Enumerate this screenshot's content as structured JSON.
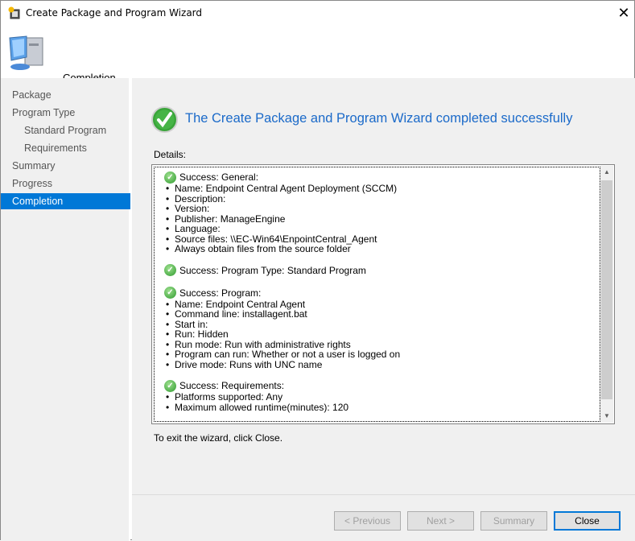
{
  "window": {
    "title": "Create Package and Program Wizard",
    "close": "✕"
  },
  "header": {
    "title": "Completion"
  },
  "nav": [
    {
      "label": "Package",
      "sub": false
    },
    {
      "label": "Program Type",
      "sub": false
    },
    {
      "label": "Standard Program",
      "sub": true
    },
    {
      "label": "Requirements",
      "sub": true
    },
    {
      "label": "Summary",
      "sub": false
    },
    {
      "label": "Progress",
      "sub": false
    },
    {
      "label": "Completion",
      "sub": false,
      "active": true
    }
  ],
  "main": {
    "heading": "The Create Package and Program Wizard completed successfully",
    "details_label": "Details:",
    "sections": [
      {
        "title": "Success: General:",
        "items": [
          "Name: Endpoint Central Agent Deployment (SCCM)",
          "Description:",
          "Version:",
          "Publisher: ManageEngine",
          "Language:",
          "Source files: \\\\EC-Win64\\EnpointCentral_Agent",
          "Always obtain files from the source folder"
        ]
      },
      {
        "title": "Success: Program Type: Standard Program",
        "items": []
      },
      {
        "title": "Success: Program:",
        "items": [
          "Name: Endpoint Central Agent",
          "Command line: installagent.bat",
          "Start in:",
          "Run: Hidden",
          "Run mode: Run with administrative rights",
          "Program can run: Whether or not a user is logged on",
          "Drive mode: Runs with UNC name"
        ]
      },
      {
        "title": "Success: Requirements:",
        "items": [
          "Platforms supported: Any",
          "Maximum allowed runtime(minutes): 120"
        ]
      }
    ],
    "exit_text": "To exit the wizard, click Close."
  },
  "buttons": {
    "previous": "< Previous",
    "next": "Next >",
    "summary": "Summary",
    "close": "Close"
  }
}
